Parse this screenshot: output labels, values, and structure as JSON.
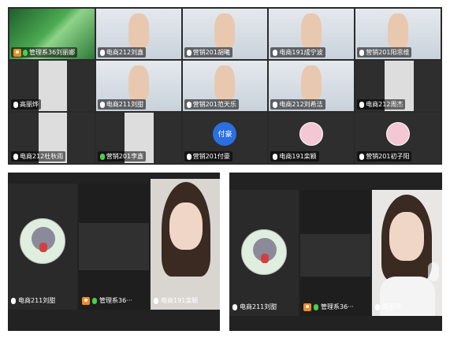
{
  "grid": {
    "tiles": [
      {
        "label": "管理系36刘丽娜",
        "host": true,
        "mic": "on",
        "bg": "leaf"
      },
      {
        "label": "电商212刘鑫",
        "host": false,
        "mic": "off",
        "bg": "room"
      },
      {
        "label": "营销201胡曦",
        "host": false,
        "mic": "off",
        "bg": "room"
      },
      {
        "label": "电商191成宁波",
        "host": false,
        "mic": "off",
        "bg": "room"
      },
      {
        "label": "营销201阳思维",
        "host": false,
        "mic": "off",
        "bg": "room"
      },
      {
        "label": "高丽烨",
        "host": false,
        "mic": "off",
        "bg": "dark"
      },
      {
        "label": "电商211刘甜",
        "host": false,
        "mic": "off",
        "bg": "room"
      },
      {
        "label": "营销201范天乐",
        "host": false,
        "mic": "off",
        "bg": "room"
      },
      {
        "label": "电商212刘希洁",
        "host": false,
        "mic": "off",
        "bg": "room"
      },
      {
        "label": "电商212周杰",
        "host": false,
        "mic": "off",
        "bg": "dark"
      },
      {
        "label": "电商212杜秋雨",
        "host": false,
        "mic": "off",
        "bg": "dark"
      },
      {
        "label": "营销201李鑫",
        "host": false,
        "mic": "on",
        "bg": "dark",
        "selected": true
      },
      {
        "label": "营销201付豪",
        "host": false,
        "mic": "off",
        "bg": "dark",
        "avatar_text": "付豪"
      },
      {
        "label": "电商191栾颖",
        "host": false,
        "mic": "off",
        "bg": "dark",
        "avatar": true
      },
      {
        "label": "营销201初子阳",
        "host": false,
        "mic": "off",
        "bg": "dark",
        "avatar": true
      }
    ]
  },
  "left_panel": {
    "tiles": [
      {
        "label": "电商211刘甜"
      },
      {
        "label": "管理系36···"
      },
      {
        "label": "电商191栾颖"
      }
    ]
  },
  "right_panel": {
    "tiles": [
      {
        "label": "电商211刘甜"
      },
      {
        "label": "管理系36···"
      },
      {
        "label": "高丽烨"
      }
    ]
  },
  "colors": {
    "host_badge": "#f08a24",
    "mic_on": "#4ad04a",
    "avatar_blue": "#2b6fe0",
    "selected_border": "#47b34b"
  }
}
